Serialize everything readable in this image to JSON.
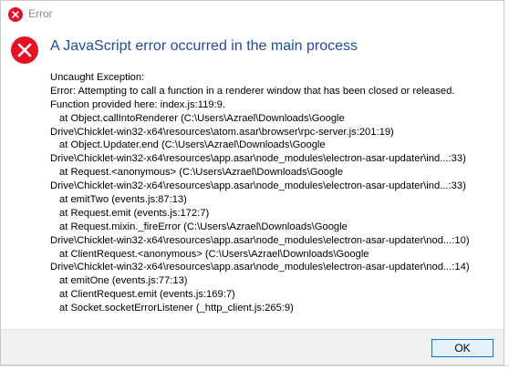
{
  "window": {
    "title": "Error",
    "close_icon": "close-icon"
  },
  "colors": {
    "error_red": "#e81123",
    "heading_blue": "#1f4aa8",
    "button_border": "#0078d7",
    "footer_bg": "#f0f0f0"
  },
  "header": {
    "icon": "error-icon",
    "text": "A JavaScript error occurred in the main process"
  },
  "message": {
    "lines": [
      "Uncaught Exception:",
      "Error: Attempting to call a function in a renderer window that has been closed or released.",
      "Function provided here: index.js:119:9.",
      "    at Object.callIntoRenderer (C:\\Users\\Azrael\\Downloads\\Google",
      "Drive\\Chicklet-win32-x64\\resources\\atom.asar\\browser\\rpc-server.js:201:19)",
      "    at Object.Updater.end (C:\\Users\\Azrael\\Downloads\\Google",
      "Drive\\Chicklet-win32-x64\\resources\\app.asar\\node_modules\\electron-asar-updater\\ind...:33)",
      "    at Request.<anonymous> (C:\\Users\\Azrael\\Downloads\\Google",
      "Drive\\Chicklet-win32-x64\\resources\\app.asar\\node_modules\\electron-asar-updater\\ind...:33)",
      "    at emitTwo (events.js:87:13)",
      "    at Request.emit (events.js:172:7)",
      "    at Request.mixin._fireError (C:\\Users\\Azrael\\Downloads\\Google",
      "Drive\\Chicklet-win32-x64\\resources\\app.asar\\node_modules\\electron-asar-updater\\nod...:10)",
      "    at ClientRequest.<anonymous> (C:\\Users\\Azrael\\Downloads\\Google",
      "Drive\\Chicklet-win32-x64\\resources\\app.asar\\node_modules\\electron-asar-updater\\nod...:14)",
      "    at emitOne (events.js:77:13)",
      "    at ClientRequest.emit (events.js:169:7)",
      "    at Socket.socketErrorListener (_http_client.js:265:9)"
    ]
  },
  "footer": {
    "ok_label": "OK"
  }
}
